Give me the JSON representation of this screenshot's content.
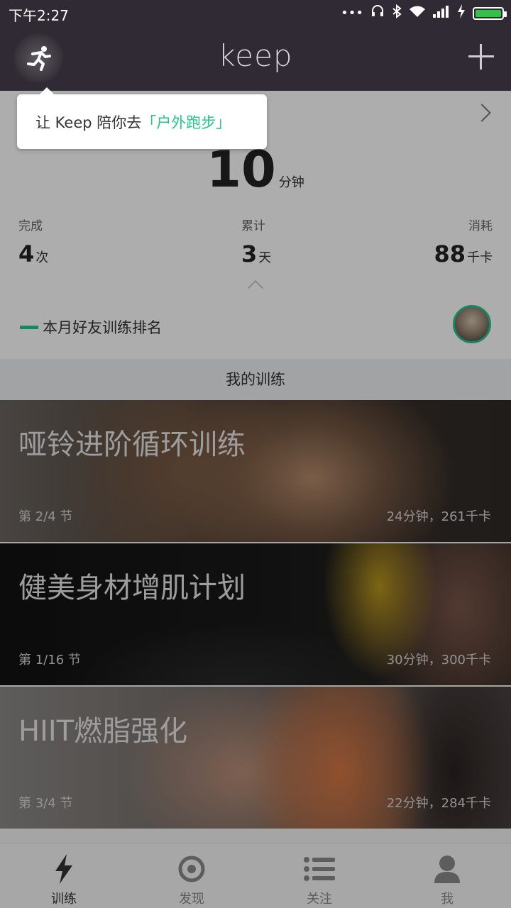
{
  "status_bar": {
    "time": "下午2:27",
    "icons": [
      "more-dots-icon",
      "headphones-icon",
      "bluetooth-icon",
      "wifi-icon",
      "signal-icon",
      "charging-icon",
      "battery-icon"
    ],
    "battery_color": "#34c04a"
  },
  "header": {
    "logo": "keep",
    "left_icon": "running-man-icon",
    "right_icon": "plus-icon",
    "background": "#2f2a33"
  },
  "tooltip": {
    "prefix": "让 Keep 陪你去",
    "highlight": "「户外跑步」",
    "highlight_color": "#24c789"
  },
  "summary": {
    "minutes_value": "10",
    "minutes_unit": "分钟",
    "stats": {
      "done": {
        "label": "完成",
        "value": "4",
        "unit": "次"
      },
      "total": {
        "label": "累计",
        "value": "3",
        "unit": "天"
      },
      "burn": {
        "label": "消耗",
        "value": "88",
        "unit": "千卡"
      }
    },
    "ranking_label": "本月好友训练排名"
  },
  "section_title": "我的训练",
  "trainings": [
    {
      "title": "哑铃进阶循环训练",
      "lesson": "第 2/4 节",
      "meta": "24分钟，261千卡"
    },
    {
      "title": "健美身材增肌计划",
      "lesson": "第 1/16 节",
      "meta": "30分钟，300千卡"
    },
    {
      "title": "HIIT燃脂强化",
      "lesson": "第 3/4 节",
      "meta": "22分钟，284千卡"
    }
  ],
  "bottom_nav": [
    {
      "label": "训练",
      "icon": "lightning-icon",
      "active": true
    },
    {
      "label": "发现",
      "icon": "discover-ring-icon",
      "active": false
    },
    {
      "label": "关注",
      "icon": "list-icon",
      "active": false
    },
    {
      "label": "我",
      "icon": "person-icon",
      "active": false
    }
  ],
  "accent_color": "#24c789"
}
